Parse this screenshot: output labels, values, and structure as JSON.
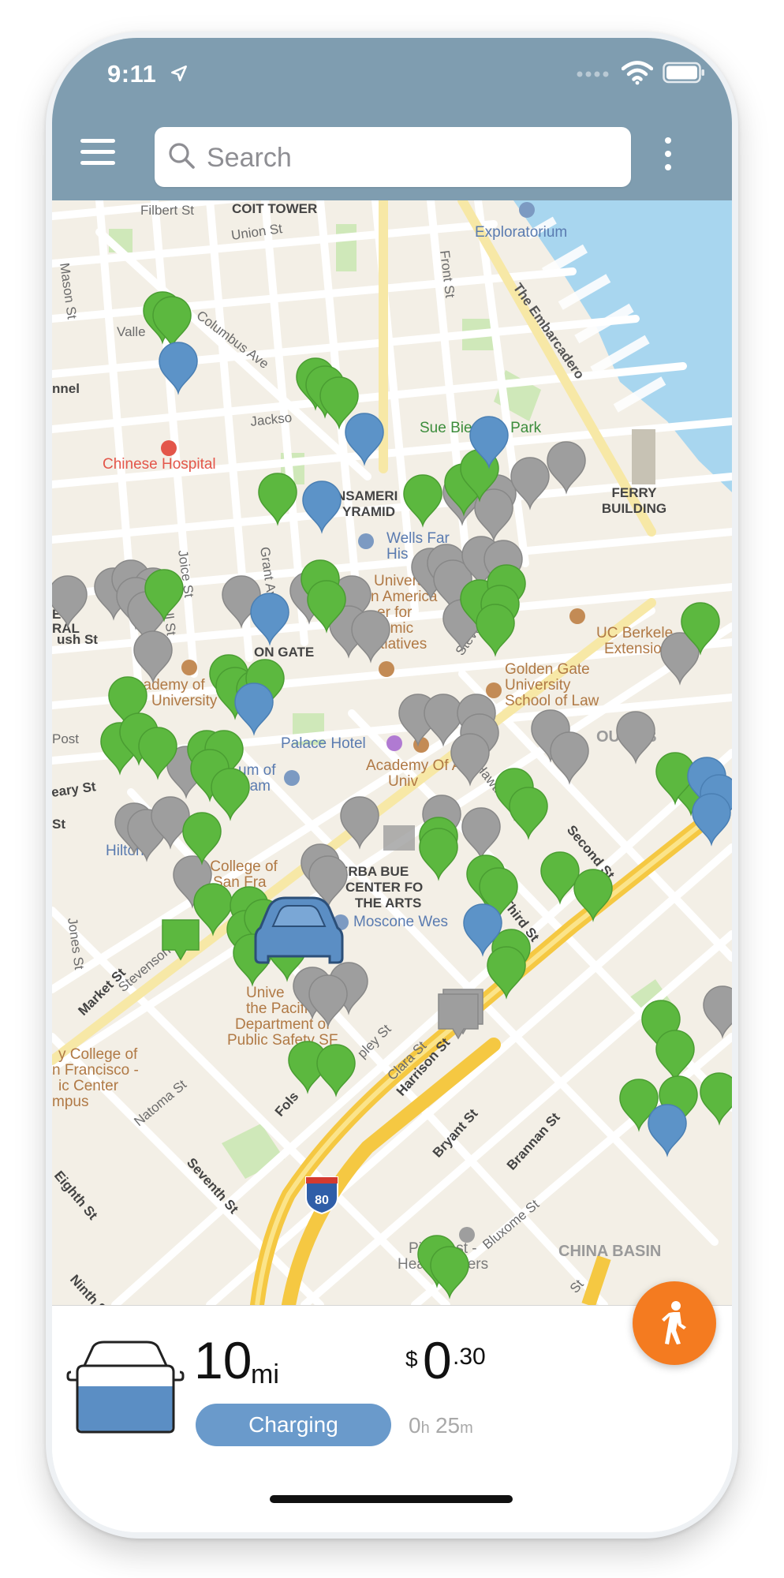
{
  "status_bar": {
    "time": "9:11"
  },
  "header": {
    "search_placeholder": "Search"
  },
  "map": {
    "labels": {
      "filbert": "Filbert St",
      "coit": "COIT TOWER",
      "union": "Union St",
      "exploratorium": "Exploratorium",
      "mason": "Mason St",
      "valle": "Valle",
      "columbus": "Columbus Ave",
      "front": "Front St",
      "embarcadero": "The Embarcadero",
      "nnel": "nnel",
      "jackson": "Jackso",
      "sue": "Sue Bierman Park",
      "chinese_hospital": "Chinese Hospital",
      "ferry_1": "FERRY",
      "ferry_2": "BUILDING",
      "pyramid_1": "NSAMERI",
      "pyramid_2": "YRAMID",
      "wells_1": "Wells Far",
      "wells_2": "His",
      "joice": "Joice St",
      "grant": "Grant Av",
      "univ_am_1": "Univers",
      "univ_am_2": "n America",
      "univ_am_3": "er for",
      "univ_am_4": "emic",
      "univ_am_5": "Initiatives",
      "ral": "RAL",
      "e_lbl": "E",
      "ll": "ll St",
      "berkeley_1": "UC Berkele",
      "berkeley_2": "Extensio",
      "ush": "ush St",
      "dragon": "ON GATE",
      "stevenson_n": "Stevenson St",
      "golden_gate_1": "Golden Gate",
      "golden_gate_2": "University",
      "golden_gate_3": "School of Law",
      "academy_1": "cademy of",
      "academy_2": "University",
      "post": "Post",
      "palace": "Palace Hotel",
      "south": "OUTH B",
      "geary": "eary St",
      "museum_1": "um of",
      "museum_2": "eam",
      "aau_1": "Academy Of Art",
      "aau_2": "Univ",
      "st_left": "St",
      "hawthorne": "Hawthorne",
      "hilton": "Hilton",
      "city_college_1": "ity College of",
      "city_college_2": "San Fra",
      "yerba_1": "ERBA BUE",
      "yerba_2": "CENTER FO",
      "yerba_3": "THE ARTS",
      "second": "Second St",
      "moscone": "Moscone Wes",
      "third": "Third St",
      "jones": "Jones St",
      "market": "Market St",
      "stevenson_s": "Stevenson St",
      "pacific_1": "Unive",
      "pacific_2": "the Pacific",
      "pacific_3": "Department of",
      "pacific_4": "Public Safety SF",
      "harrison": "Harrison St",
      "cc2_1": "y College of",
      "cc2_2": "n Francisco -",
      "cc2_3": "ic Center",
      "cc2_4": "mpus",
      "natoma": "Natoma St",
      "clara": "Clara St",
      "shipley": "pley St",
      "folsom": "Fols",
      "bryant": "Bryant St",
      "brannan": "Brannan St",
      "eighth": "Eighth St",
      "seventh": "Seventh St",
      "i80": "80",
      "bluxome": "Bluxome St",
      "china_basin": "CHINA BASIN",
      "pinterest_1": "Pinterest -",
      "pinterest_2": "Headquarters",
      "ninth": "Ninth S",
      "st_br": "St"
    },
    "pin_colors": {
      "green": "#5cb83f",
      "gray": "#9e9e9e",
      "blue": "#5c93c8",
      "car": "#5b8ec4"
    }
  },
  "vehicle": {
    "range_value": "10",
    "range_unit": "mi",
    "cost_currency": "$",
    "cost_whole": "0",
    "cost_cents": ".30",
    "status_label": "Charging",
    "time_hours": "0",
    "time_hours_unit": "h",
    "time_minutes": "25",
    "time_minutes_unit": "m"
  },
  "colors": {
    "header_bg": "#7f9db0",
    "accent_orange": "#f47b20",
    "charging_blue": "#6a9acb"
  }
}
